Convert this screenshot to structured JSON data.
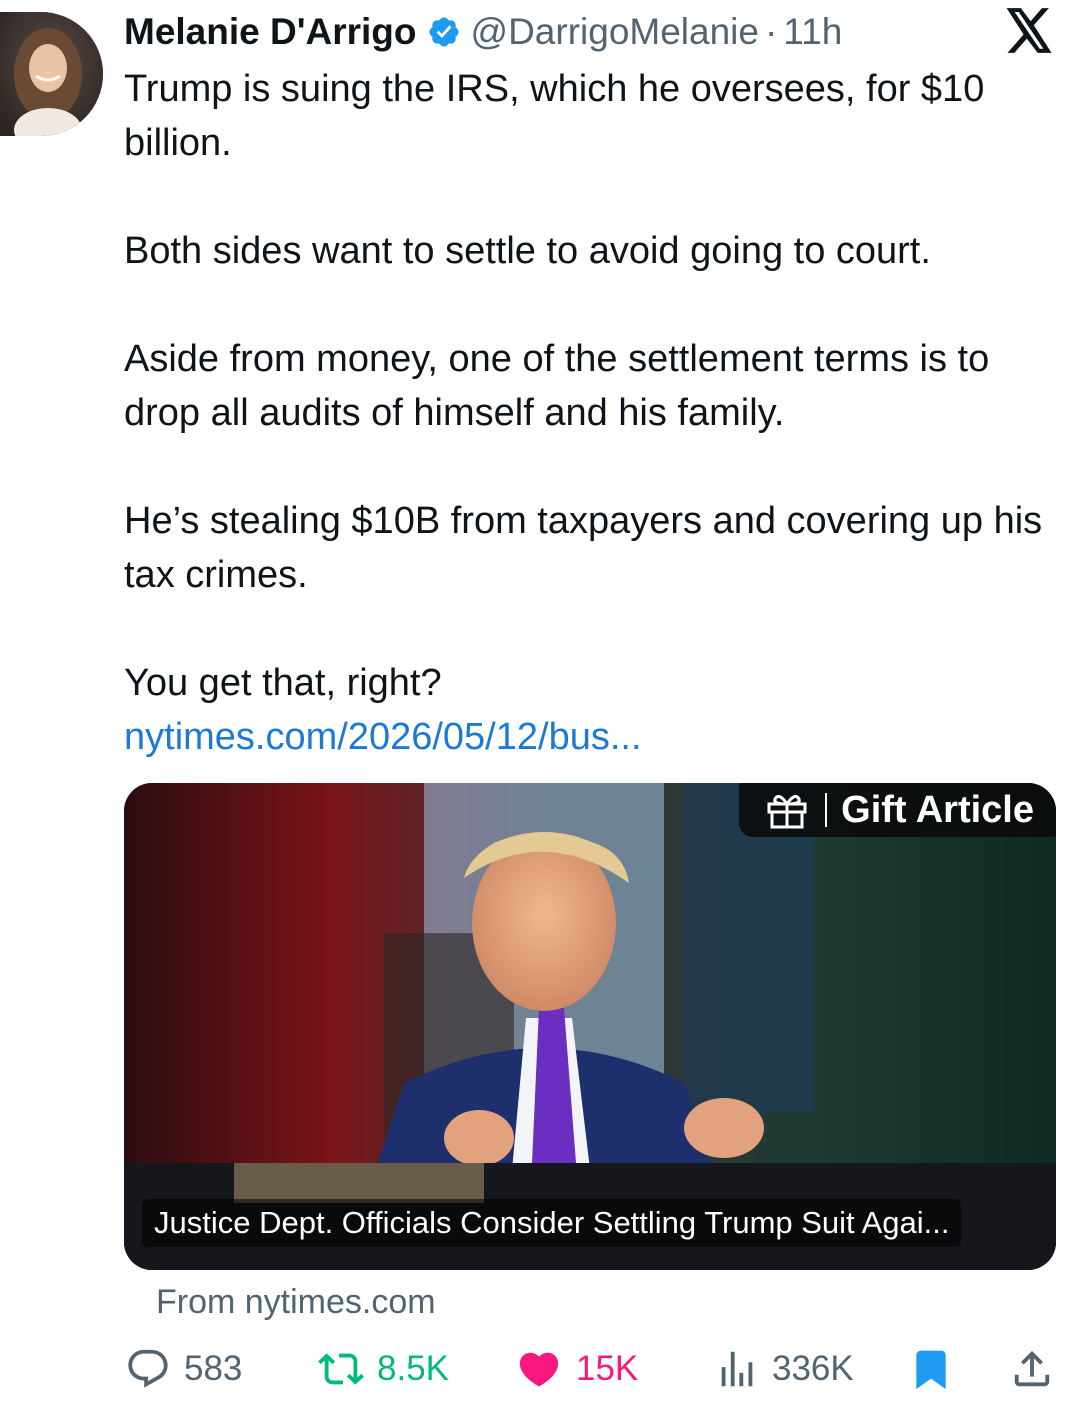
{
  "author": {
    "display_name": "Melanie D'Arrigo",
    "handle": "@DarrigoMelanie",
    "separator": "·",
    "time": "11h",
    "verified_icon": "verified-badge-icon"
  },
  "platform_icon": "x-logo-icon",
  "tweet": {
    "paragraphs": [
      "Trump is suing the IRS, which he oversees, for $10 billion.",
      "Both sides want to settle to avoid going to court.",
      "Aside from money, one of the settlement terms is to drop all audits of himself and his family.",
      "He’s stealing $10B from taxpayers and covering up his tax crimes.",
      "You get that, right?"
    ],
    "link_text": "nytimes.com/2026/05/12/bus..."
  },
  "card": {
    "badge_icon": "gift-icon",
    "badge_label": "Gift Article",
    "headline": "Justice Dept. Officials Consider Settling Trump Suit Agai...",
    "source": "From nytimes.com"
  },
  "actions": {
    "replies": "583",
    "reposts": "8.5K",
    "likes": "15K",
    "views": "336K"
  },
  "colors": {
    "text": "#0f1419",
    "secondary": "#536471",
    "link": "#1d7ad4",
    "verified": "#1d9bf0",
    "repost_active": "#00ba7c",
    "like_active": "#f91880",
    "bookmark_active": "#1d9bf0"
  }
}
